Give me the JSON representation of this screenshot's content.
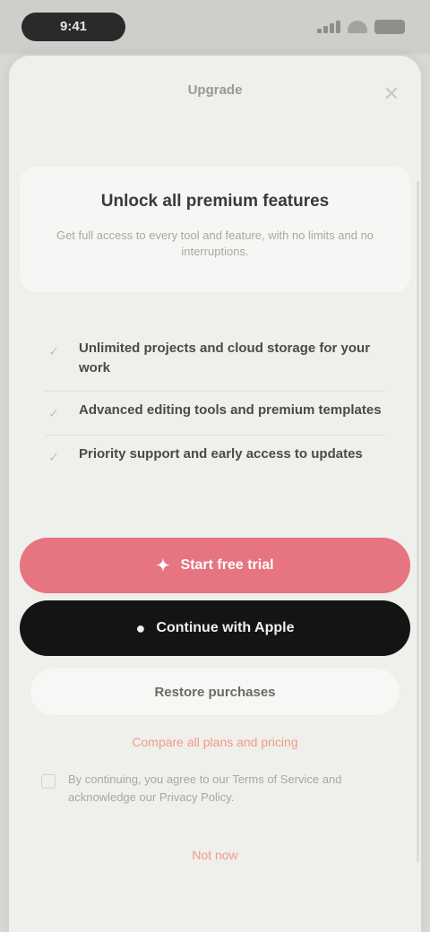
{
  "status_bar": {
    "time": "9:41",
    "icons": [
      "signal-icon",
      "wifi-icon",
      "battery-icon"
    ]
  },
  "sheet": {
    "title": "Upgrade",
    "close_icon": "close-icon"
  },
  "info_card": {
    "heading": "Unlock all premium features",
    "subtitle": "Get full access to every tool and feature, with no limits and no interruptions."
  },
  "features": [
    {
      "icon": "check-icon",
      "text": "Unlimited projects and cloud storage for your work"
    },
    {
      "icon": "check-icon",
      "text": "Advanced editing tools and premium templates"
    },
    {
      "icon": "check-icon",
      "text": "Priority support and early access to updates"
    }
  ],
  "buttons": {
    "primary": {
      "label": "Start free trial",
      "icon": "sparkle-icon"
    },
    "dark": {
      "label": "Continue with Apple",
      "icon": "apple-icon"
    },
    "outline": {
      "label": "Restore purchases"
    }
  },
  "links": {
    "accent": "Compare all plans and pricing",
    "footer": "Not now"
  },
  "terms": {
    "text": "By continuing, you agree to our Terms of Service and acknowledge our Privacy Policy."
  },
  "colors": {
    "primary": "#e67481",
    "dark": "#141414",
    "accent_link": "#ef9b86",
    "sheet_bg": "#efefeb"
  }
}
